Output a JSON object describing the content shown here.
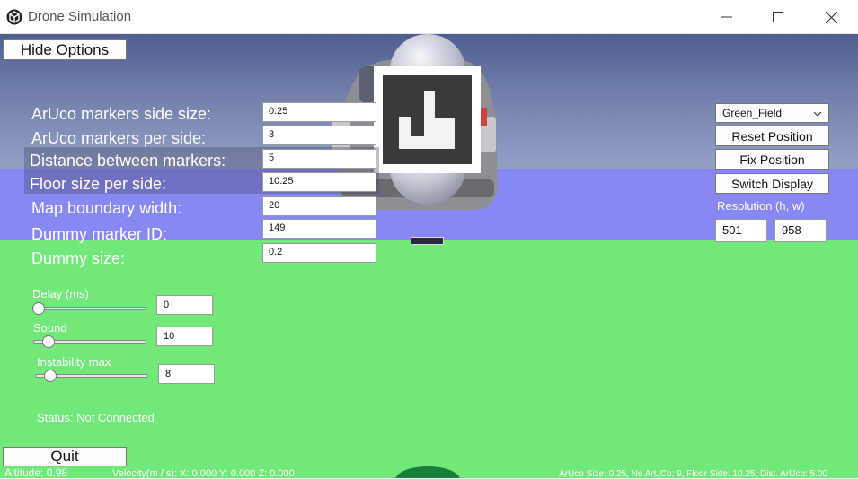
{
  "window": {
    "title": "Drone Simulation",
    "icon": "unity-logo-icon",
    "controls": {
      "minimize": "minimize-icon",
      "maximize": "maximize-icon",
      "close": "close-icon"
    }
  },
  "buttons": {
    "hide_options": "Hide Options",
    "quit": "Quit",
    "reset_position": "Reset Position",
    "fix_position": "Fix Position",
    "switch_display": "Switch Display"
  },
  "options": [
    {
      "label": "ArUco markers side size:",
      "value": "0.25"
    },
    {
      "label": "ArUco markers per side:",
      "value": "3"
    },
    {
      "label": "Distance between markers:",
      "value": "5"
    },
    {
      "label": "Floor size per side:",
      "value": "10.25"
    },
    {
      "label": "Map boundary width:",
      "value": "20"
    },
    {
      "label": "Dummy marker ID:",
      "value": "149"
    },
    {
      "label": "Dummy size:",
      "value": "0.2"
    }
  ],
  "sliders": [
    {
      "label": "Delay (ms)",
      "value": "0",
      "fraction": 0
    },
    {
      "label": "Sound",
      "value": "10",
      "fraction": 0.1
    },
    {
      "label": "Instability max",
      "value": "8",
      "fraction": 0.1
    }
  ],
  "status": "Status: Not Connected",
  "scene_dropdown": {
    "selected": "Green_Field"
  },
  "resolution": {
    "label": "Resolution (h, w)",
    "h": "501",
    "w": "958"
  },
  "hud": {
    "altitude": "Altitude: 0.98",
    "velocity": "Velocity(m / s):  X: 0.000 Y: 0.000 Z: 0.000",
    "info": "ArUco Size: 0.25, No ArUCo: 9, Floor Side: 10.25, Dist. ArUco: 5.00"
  },
  "colors": {
    "ground": "#72e77a",
    "band": "#8888f2",
    "marker_dark": "#3a3a3a"
  }
}
